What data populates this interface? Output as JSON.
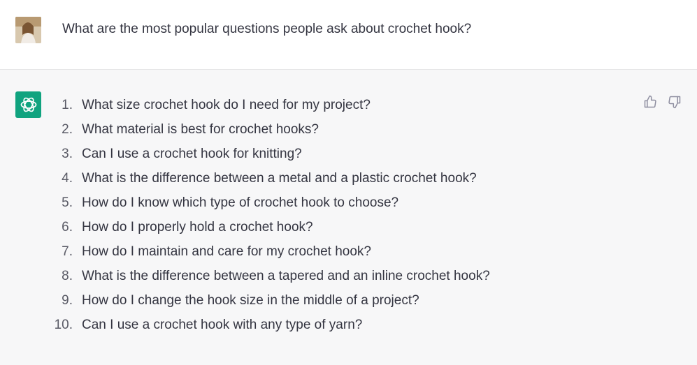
{
  "user_message": {
    "avatar": "user-photo-avatar",
    "text": "What are the most popular questions people ask about crochet hook?"
  },
  "assistant_message": {
    "logo": "openai-logo-icon",
    "items": [
      {
        "num": "1.",
        "text": "What size crochet hook do I need for my project?"
      },
      {
        "num": "2.",
        "text": "What material is best for crochet hooks?"
      },
      {
        "num": "3.",
        "text": "Can I use a crochet hook for knitting?"
      },
      {
        "num": "4.",
        "text": "What is the difference between a metal and a plastic crochet hook?"
      },
      {
        "num": "5.",
        "text": "How do I know which type of crochet hook to choose?"
      },
      {
        "num": "6.",
        "text": "How do I properly hold a crochet hook?"
      },
      {
        "num": "7.",
        "text": "How do I maintain and care for my crochet hook?"
      },
      {
        "num": "8.",
        "text": "What is the difference between a tapered and an inline crochet hook?"
      },
      {
        "num": "9.",
        "text": "How do I change the hook size in the middle of a project?"
      },
      {
        "num": "10.",
        "text": "Can I use a crochet hook with any type of yarn?"
      }
    ],
    "feedback": {
      "up_icon": "thumbs-up-icon",
      "down_icon": "thumbs-down-icon"
    }
  },
  "colors": {
    "accent": "#10a37f",
    "text": "#343541",
    "assistant_bg": "#f7f7f8"
  }
}
